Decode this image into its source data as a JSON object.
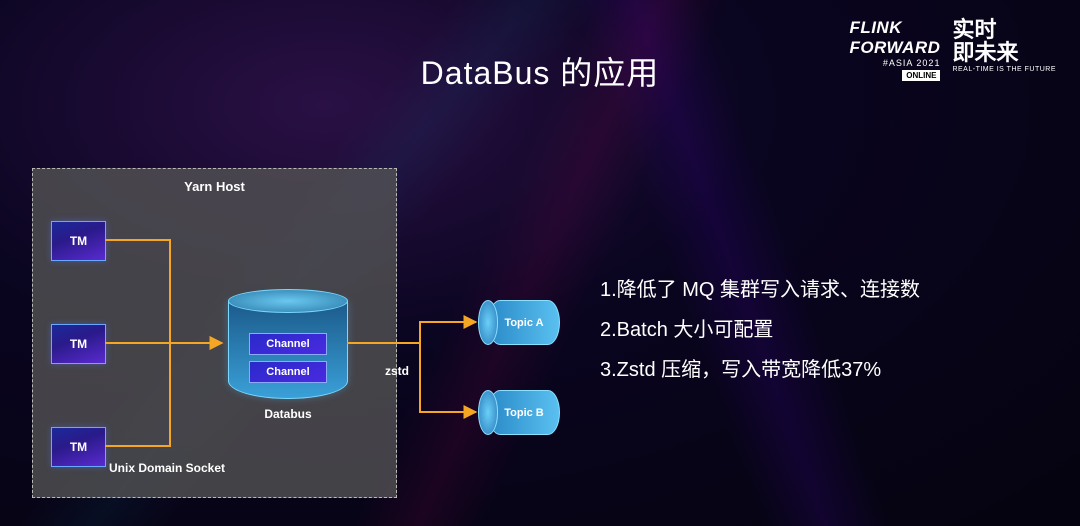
{
  "title": "DataBus 的应用",
  "logo": {
    "line1": "FLINK",
    "line2": "FORWARD",
    "asia": "#ASIA 2021",
    "online": "ONLINE",
    "cn1": "实时",
    "cn2": "即未来",
    "tag": "REAL-TIME IS THE FUTURE"
  },
  "diagram": {
    "panel_title": "Yarn Host",
    "tm": "TM",
    "channel": "Channel",
    "databus": "Databus",
    "uds": "Unix Domain Socket",
    "zstd": "zstd",
    "topicA": "Topic A",
    "topicB": "Topic B"
  },
  "bullets": {
    "b1": "1.降低了 MQ 集群写入请求、连接数",
    "b2": "2.Batch 大小可配置",
    "b3": "3.Zstd 压缩，写入带宽降低37%"
  }
}
